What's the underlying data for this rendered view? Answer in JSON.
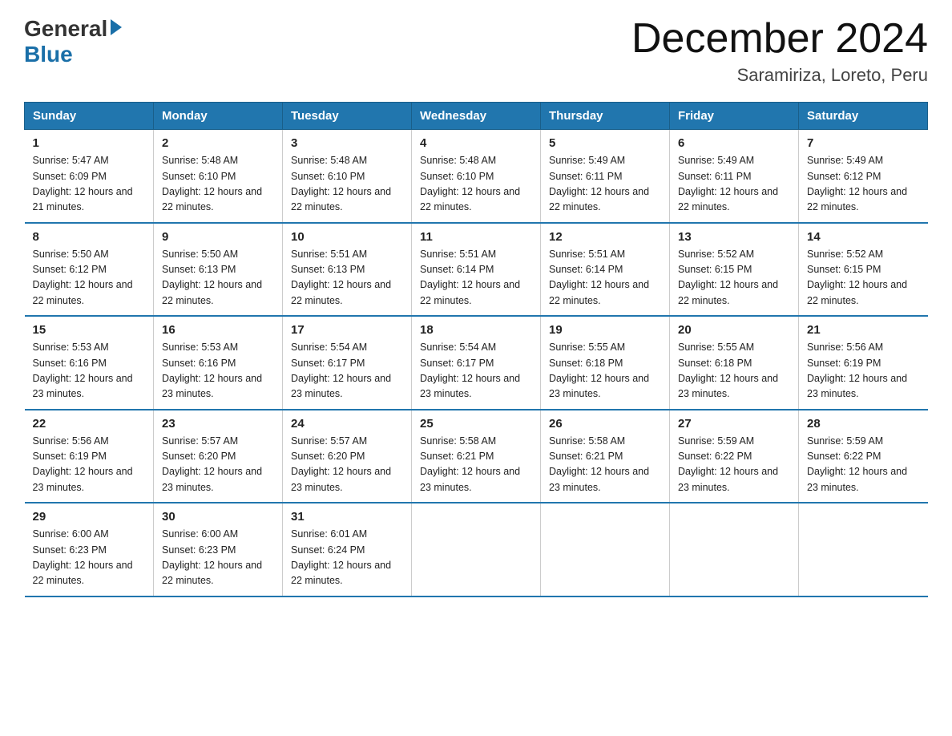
{
  "logo": {
    "general": "General",
    "blue": "Blue"
  },
  "title": "December 2024",
  "subtitle": "Saramiriza, Loreto, Peru",
  "headers": [
    "Sunday",
    "Monday",
    "Tuesday",
    "Wednesday",
    "Thursday",
    "Friday",
    "Saturday"
  ],
  "weeks": [
    [
      {
        "day": "1",
        "sunrise": "5:47 AM",
        "sunset": "6:09 PM",
        "daylight": "12 hours and 21 minutes."
      },
      {
        "day": "2",
        "sunrise": "5:48 AM",
        "sunset": "6:10 PM",
        "daylight": "12 hours and 22 minutes."
      },
      {
        "day": "3",
        "sunrise": "5:48 AM",
        "sunset": "6:10 PM",
        "daylight": "12 hours and 22 minutes."
      },
      {
        "day": "4",
        "sunrise": "5:48 AM",
        "sunset": "6:10 PM",
        "daylight": "12 hours and 22 minutes."
      },
      {
        "day": "5",
        "sunrise": "5:49 AM",
        "sunset": "6:11 PM",
        "daylight": "12 hours and 22 minutes."
      },
      {
        "day": "6",
        "sunrise": "5:49 AM",
        "sunset": "6:11 PM",
        "daylight": "12 hours and 22 minutes."
      },
      {
        "day": "7",
        "sunrise": "5:49 AM",
        "sunset": "6:12 PM",
        "daylight": "12 hours and 22 minutes."
      }
    ],
    [
      {
        "day": "8",
        "sunrise": "5:50 AM",
        "sunset": "6:12 PM",
        "daylight": "12 hours and 22 minutes."
      },
      {
        "day": "9",
        "sunrise": "5:50 AM",
        "sunset": "6:13 PM",
        "daylight": "12 hours and 22 minutes."
      },
      {
        "day": "10",
        "sunrise": "5:51 AM",
        "sunset": "6:13 PM",
        "daylight": "12 hours and 22 minutes."
      },
      {
        "day": "11",
        "sunrise": "5:51 AM",
        "sunset": "6:14 PM",
        "daylight": "12 hours and 22 minutes."
      },
      {
        "day": "12",
        "sunrise": "5:51 AM",
        "sunset": "6:14 PM",
        "daylight": "12 hours and 22 minutes."
      },
      {
        "day": "13",
        "sunrise": "5:52 AM",
        "sunset": "6:15 PM",
        "daylight": "12 hours and 22 minutes."
      },
      {
        "day": "14",
        "sunrise": "5:52 AM",
        "sunset": "6:15 PM",
        "daylight": "12 hours and 22 minutes."
      }
    ],
    [
      {
        "day": "15",
        "sunrise": "5:53 AM",
        "sunset": "6:16 PM",
        "daylight": "12 hours and 23 minutes."
      },
      {
        "day": "16",
        "sunrise": "5:53 AM",
        "sunset": "6:16 PM",
        "daylight": "12 hours and 23 minutes."
      },
      {
        "day": "17",
        "sunrise": "5:54 AM",
        "sunset": "6:17 PM",
        "daylight": "12 hours and 23 minutes."
      },
      {
        "day": "18",
        "sunrise": "5:54 AM",
        "sunset": "6:17 PM",
        "daylight": "12 hours and 23 minutes."
      },
      {
        "day": "19",
        "sunrise": "5:55 AM",
        "sunset": "6:18 PM",
        "daylight": "12 hours and 23 minutes."
      },
      {
        "day": "20",
        "sunrise": "5:55 AM",
        "sunset": "6:18 PM",
        "daylight": "12 hours and 23 minutes."
      },
      {
        "day": "21",
        "sunrise": "5:56 AM",
        "sunset": "6:19 PM",
        "daylight": "12 hours and 23 minutes."
      }
    ],
    [
      {
        "day": "22",
        "sunrise": "5:56 AM",
        "sunset": "6:19 PM",
        "daylight": "12 hours and 23 minutes."
      },
      {
        "day": "23",
        "sunrise": "5:57 AM",
        "sunset": "6:20 PM",
        "daylight": "12 hours and 23 minutes."
      },
      {
        "day": "24",
        "sunrise": "5:57 AM",
        "sunset": "6:20 PM",
        "daylight": "12 hours and 23 minutes."
      },
      {
        "day": "25",
        "sunrise": "5:58 AM",
        "sunset": "6:21 PM",
        "daylight": "12 hours and 23 minutes."
      },
      {
        "day": "26",
        "sunrise": "5:58 AM",
        "sunset": "6:21 PM",
        "daylight": "12 hours and 23 minutes."
      },
      {
        "day": "27",
        "sunrise": "5:59 AM",
        "sunset": "6:22 PM",
        "daylight": "12 hours and 23 minutes."
      },
      {
        "day": "28",
        "sunrise": "5:59 AM",
        "sunset": "6:22 PM",
        "daylight": "12 hours and 23 minutes."
      }
    ],
    [
      {
        "day": "29",
        "sunrise": "6:00 AM",
        "sunset": "6:23 PM",
        "daylight": "12 hours and 22 minutes."
      },
      {
        "day": "30",
        "sunrise": "6:00 AM",
        "sunset": "6:23 PM",
        "daylight": "12 hours and 22 minutes."
      },
      {
        "day": "31",
        "sunrise": "6:01 AM",
        "sunset": "6:24 PM",
        "daylight": "12 hours and 22 minutes."
      },
      null,
      null,
      null,
      null
    ]
  ]
}
